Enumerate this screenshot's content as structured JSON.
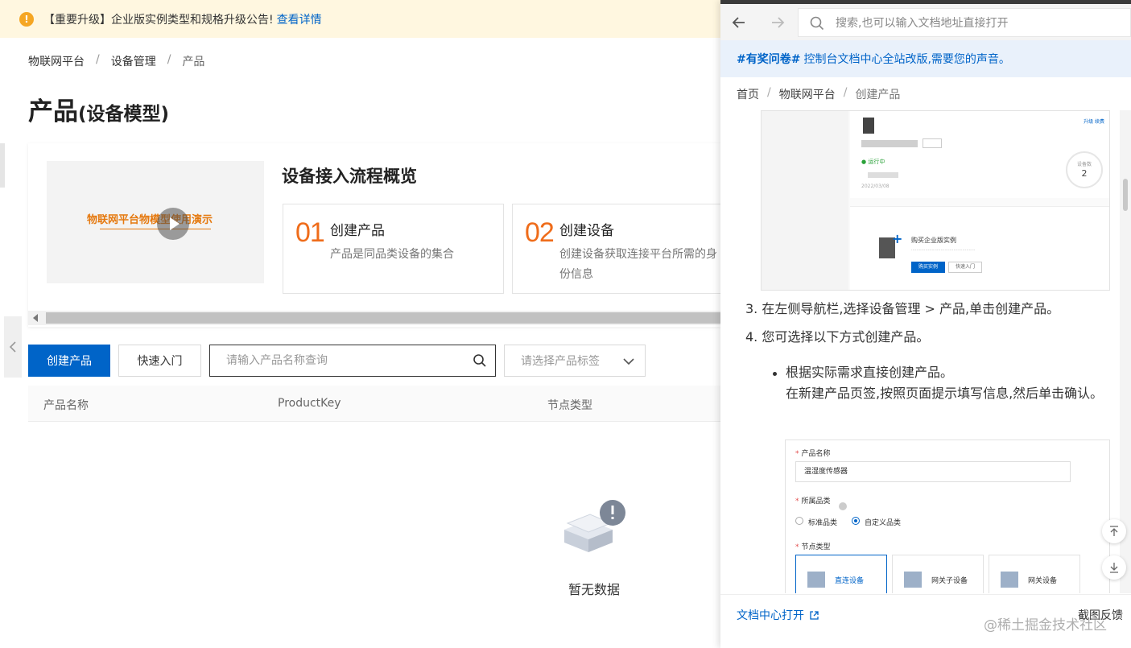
{
  "notice": {
    "text": "【重要升级】企业版实例类型和规格升级公告!",
    "link": "查看详情"
  },
  "breadcrumb": [
    "物联网平台",
    "设备管理",
    "产品"
  ],
  "page": {
    "title": "产品",
    "subtitle": "(设备模型)"
  },
  "overview": {
    "video_title": "物联网平台物模型使用演示",
    "title": "设备接入流程概览",
    "steps": [
      {
        "num": "01",
        "title": "创建产品",
        "desc": "产品是同品类设备的集合"
      },
      {
        "num": "02",
        "title": "创建设备",
        "desc": "创建设备获取连接平台所需的身份信息"
      }
    ]
  },
  "toolbar": {
    "create_label": "创建产品",
    "quick_label": "快速入门",
    "search_placeholder": "请输入产品名称查询",
    "tag_placeholder": "请选择产品标签"
  },
  "table": {
    "columns": [
      "产品名称",
      "ProductKey",
      "节点类型"
    ]
  },
  "empty": {
    "text": "暂无数据"
  },
  "doc": {
    "search_placeholder": "搜索,也可以输入文档地址直接打开",
    "survey_tag": "#有奖问卷#",
    "survey_text": "控制台文档中心全站改版,需要您的声音。",
    "breadcrumb": [
      "首页",
      "物联网平台",
      "创建产品"
    ],
    "shot1": {
      "status": "运行中",
      "date": "2022/03/08",
      "links": "升级  续费",
      "ring_label": "设备数",
      "ring_value": "2",
      "promo_title": "购买企业版实例",
      "buy": "购买实例",
      "quick": "快速入门"
    },
    "step3": "3. 在左侧导航栏,选择设备管理 > 产品,单击创建产品。",
    "step4": "4. 您可选择以下方式创建产品。",
    "bullet_title": "根据实际需求直接创建产品。",
    "bullet_desc": "在新建产品页签,按照页面提示填写信息,然后单击确认。",
    "form": {
      "name_label": "产品名称",
      "name_value": "温湿度传感器",
      "category_label": "所属品类",
      "cat_standard": "标准品类",
      "cat_custom": "自定义品类",
      "node_label": "节点类型",
      "nodes": [
        "直连设备",
        "网关子设备",
        "网关设备"
      ]
    },
    "footer_open": "文档中心打开",
    "footer_feedback": "截图反馈"
  },
  "watermark": "@稀土掘金技术社区"
}
